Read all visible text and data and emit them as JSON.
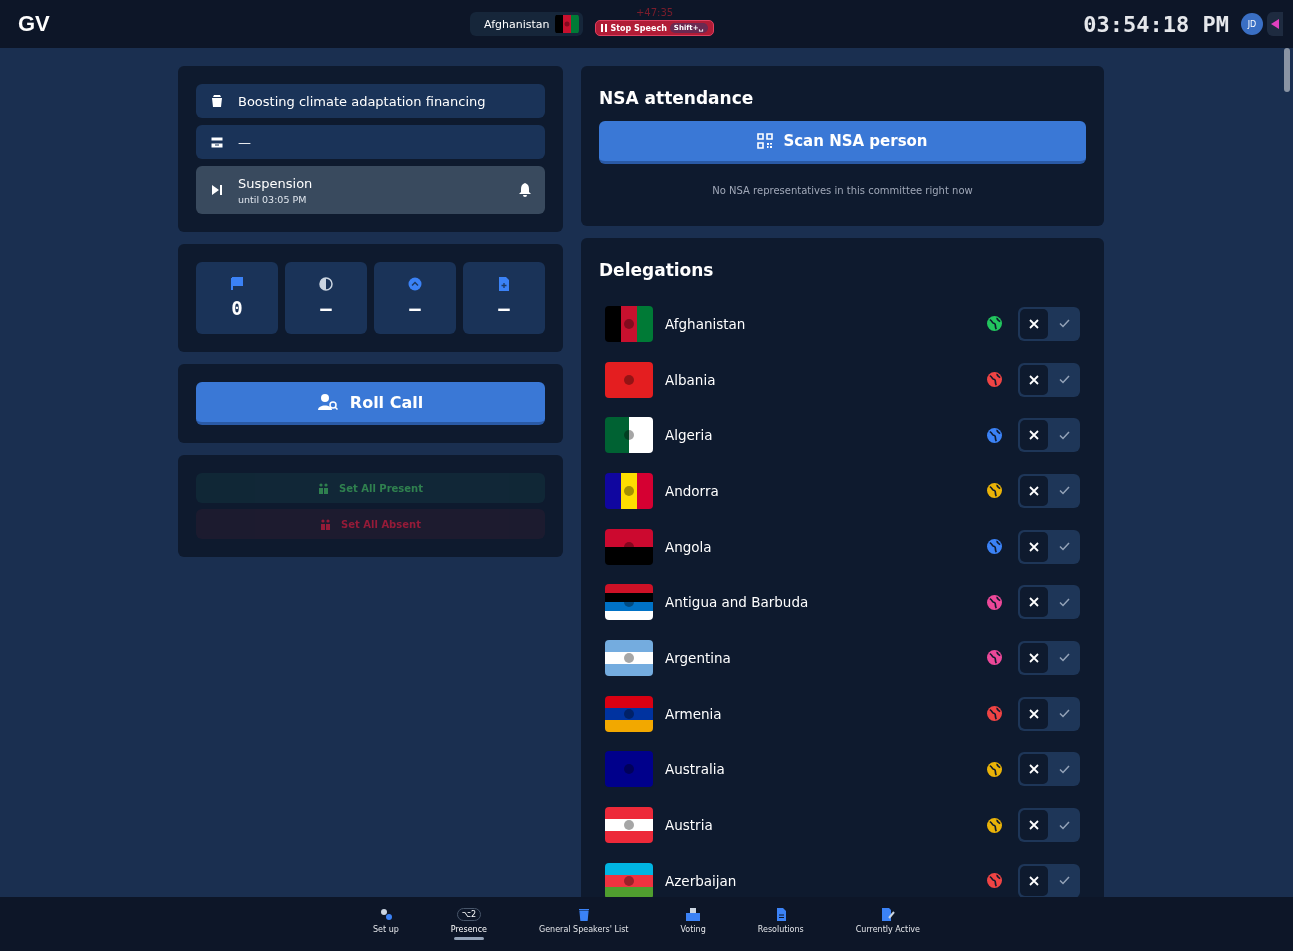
{
  "header": {
    "logo": "GV",
    "speaker": {
      "country": "Afghanistan"
    },
    "timer": "+47:35",
    "stop_button": {
      "label": "Stop Speech",
      "shortcut": "Shift+␣"
    },
    "clock": "03:54:18 PM",
    "avatar": "JD"
  },
  "agenda": [
    {
      "kind": "topic",
      "text": "Boosting climate adaptation financing"
    },
    {
      "kind": "motion",
      "text": "—"
    },
    {
      "kind": "session",
      "text": "Suspension",
      "subtext": "until 03:05 PM"
    }
  ],
  "stats": [
    {
      "kind": "flag",
      "value": "0"
    },
    {
      "kind": "half",
      "value": "—"
    },
    {
      "kind": "up",
      "value": "—"
    },
    {
      "kind": "doc",
      "value": "—"
    }
  ],
  "roll_call": {
    "label": "Roll Call"
  },
  "bulk": [
    {
      "kind": "present",
      "label": "Set All Present",
      "disabled": true
    },
    {
      "kind": "absent",
      "label": "Set All Absent",
      "disabled": true
    }
  ],
  "nsa": {
    "title": "NSA attendance",
    "button": "Scan NSA person",
    "empty": "No NSA representatives in this committee right now"
  },
  "delegations": {
    "title": "Delegations",
    "items": [
      {
        "name": "Afghanistan",
        "color": "#22c55e",
        "present": false
      },
      {
        "name": "Albania",
        "color": "#ef4444",
        "present": false
      },
      {
        "name": "Algeria",
        "color": "#3b82f6",
        "present": false
      },
      {
        "name": "Andorra",
        "color": "#eab308",
        "present": false
      },
      {
        "name": "Angola",
        "color": "#3b82f6",
        "present": false
      },
      {
        "name": "Antigua and Barbuda",
        "color": "#ec4899",
        "present": false
      },
      {
        "name": "Argentina",
        "color": "#ec4899",
        "present": false
      },
      {
        "name": "Armenia",
        "color": "#ef4444",
        "present": false
      },
      {
        "name": "Australia",
        "color": "#eab308",
        "present": false
      },
      {
        "name": "Austria",
        "color": "#eab308",
        "present": false
      },
      {
        "name": "Azerbaijan",
        "color": "#ef4444",
        "present": false
      }
    ]
  },
  "nav": [
    {
      "label": "Set up",
      "selected": false
    },
    {
      "label": "Presence",
      "badge": "⌥2",
      "selected": true
    },
    {
      "label": "General Speakers' List",
      "selected": false
    },
    {
      "label": "Voting",
      "selected": false
    },
    {
      "label": "Resolutions",
      "selected": false
    },
    {
      "label": "Currently Active",
      "selected": false
    }
  ]
}
